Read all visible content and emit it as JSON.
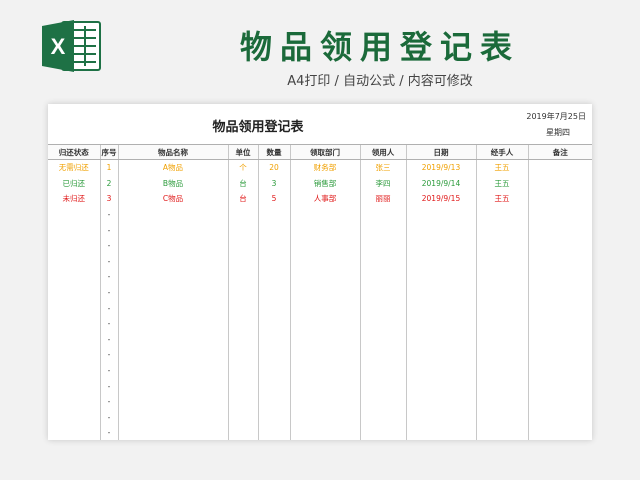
{
  "header": {
    "title": "物品领用登记表",
    "subtitle": "A4打印 / 自动公式 / 内容可修改",
    "logo_letter": "X"
  },
  "sheet": {
    "title": "物品领用登记表",
    "date": "2019年7月25日",
    "weekday": "星期四"
  },
  "columns": [
    "归还状态",
    "序号",
    "物品名称",
    "单位",
    "数量",
    "领取部门",
    "领用人",
    "日期",
    "经手人",
    "备注"
  ],
  "rows": [
    {
      "status": "无需归还",
      "no": "1",
      "item": "A物品",
      "unit": "个",
      "qty": "20",
      "dept": "财务部",
      "person": "张三",
      "date": "2019/9/13",
      "handler": "王五",
      "note": ""
    },
    {
      "status": "已归还",
      "no": "2",
      "item": "B物品",
      "unit": "台",
      "qty": "3",
      "dept": "销售部",
      "person": "李四",
      "date": "2019/9/14",
      "handler": "王五",
      "note": ""
    },
    {
      "status": "未归还",
      "no": "3",
      "item": "C物品",
      "unit": "台",
      "qty": "5",
      "dept": "人事部",
      "person": "丽丽",
      "date": "2019/9/15",
      "handler": "王五",
      "note": ""
    }
  ],
  "blank_marker": "-",
  "colors": {
    "brand_green": "#1b6a3a",
    "excel_green": "#1e7145",
    "orange": "#f0a000",
    "green": "#2a9a3a",
    "red": "#e01818"
  }
}
